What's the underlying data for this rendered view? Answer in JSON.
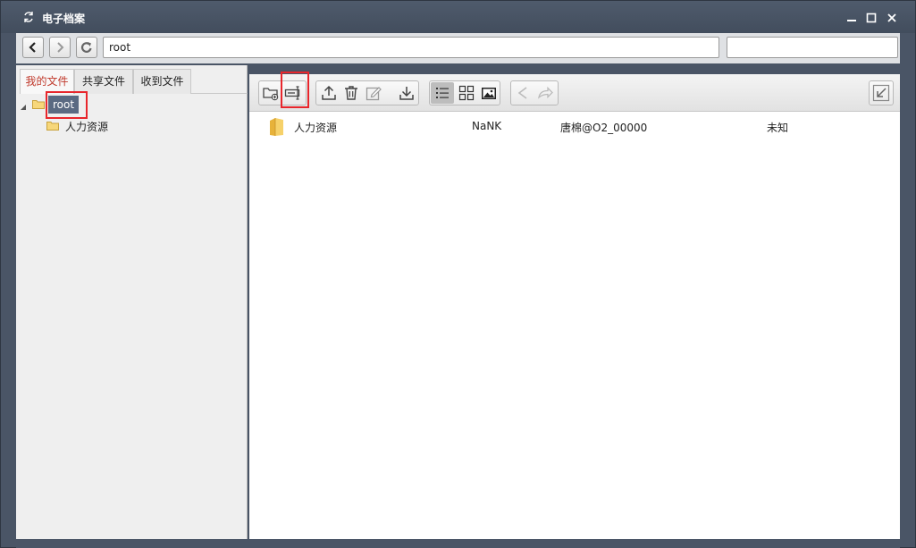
{
  "window": {
    "title": "电子档案",
    "icons": {
      "app": "refresh-icon",
      "minimize": "minimize-icon",
      "maximize": "maximize-icon",
      "close": "close-icon"
    }
  },
  "nav": {
    "back_icon": "chevron-left-icon",
    "forward_icon": "chevron-right-icon",
    "refresh_icon": "refresh-icon",
    "path_value": "root",
    "search_value": ""
  },
  "sidebar": {
    "tabs": [
      {
        "label": "我的文件",
        "active": true
      },
      {
        "label": "共享文件",
        "active": false
      },
      {
        "label": "收到文件",
        "active": false
      }
    ],
    "tree": {
      "root": {
        "label": "root",
        "selected": true
      },
      "children": [
        {
          "label": "人力资源"
        }
      ]
    }
  },
  "toolbar": {
    "groups": [
      [
        "new-folder-icon",
        "rename-icon"
      ],
      [
        "upload-icon",
        "delete-icon",
        "edit-icon",
        "download-icon"
      ],
      [
        "list-view-icon",
        "grid-view-icon",
        "image-view-icon"
      ],
      [
        "share-icon",
        "forward-icon"
      ],
      [
        "collapse-icon"
      ]
    ]
  },
  "files": [
    {
      "name": "人力资源",
      "size": "NaNK",
      "owner": "唐棉@O2_00000",
      "status": "未知"
    }
  ],
  "colors": {
    "highlight": "#e8262c",
    "active_tab_text": "#c0392b",
    "selected_node": "#5a6a82"
  }
}
